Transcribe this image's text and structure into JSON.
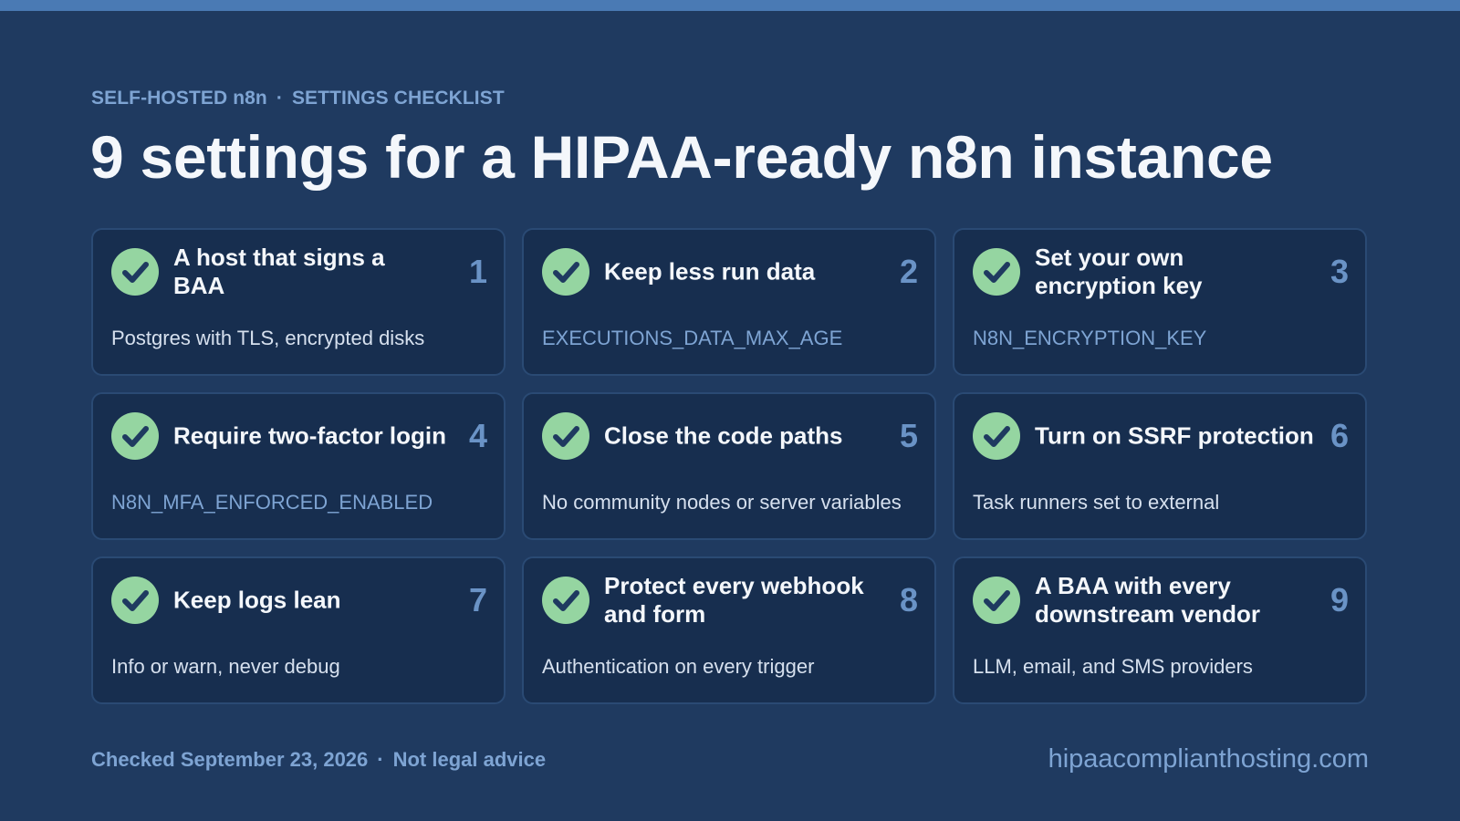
{
  "colors": {
    "background": "#1f3a60",
    "top_bar": "#4a7ab4",
    "card_background": "#172e4f",
    "card_border": "#2a4a74",
    "check_green": "#95d5a1",
    "check_mark": "#1f3a60",
    "accent_blue": "#7ea4d3",
    "number_blue": "#6a93c6",
    "title_white": "#f4f7fb"
  },
  "header": {
    "eyebrow_left": "SELF-HOSTED n8n",
    "eyebrow_separator": "·",
    "eyebrow_right": "SETTINGS CHECKLIST",
    "title": "9 settings for a HIPAA-ready n8n instance"
  },
  "cards": [
    {
      "number": "1",
      "title": "A host that signs a BAA",
      "subtitle": "Postgres with TLS, encrypted disks",
      "icon": "check-circle-icon"
    },
    {
      "number": "2",
      "title": "Keep less run data",
      "subtitle": "EXECUTIONS_DATA_MAX_AGE",
      "icon": "check-circle-icon"
    },
    {
      "number": "3",
      "title": "Set your own encryption key",
      "subtitle": "N8N_ENCRYPTION_KEY",
      "icon": "check-circle-icon"
    },
    {
      "number": "4",
      "title": "Require two-factor login",
      "subtitle": "N8N_MFA_ENFORCED_ENABLED",
      "icon": "check-circle-icon"
    },
    {
      "number": "5",
      "title": "Close the code paths",
      "subtitle": "No community nodes or server variables",
      "icon": "check-circle-icon"
    },
    {
      "number": "6",
      "title": "Turn on SSRF protection",
      "subtitle": "Task runners set to external",
      "icon": "check-circle-icon"
    },
    {
      "number": "7",
      "title": "Keep logs lean",
      "subtitle": "Info or warn, never debug",
      "icon": "check-circle-icon"
    },
    {
      "number": "8",
      "title": "Protect every webhook and form",
      "subtitle": "Authentication on every trigger",
      "icon": "check-circle-icon"
    },
    {
      "number": "9",
      "title": "A BAA with every downstream vendor",
      "subtitle": "LLM, email, and SMS providers",
      "icon": "check-circle-icon"
    }
  ],
  "footer": {
    "checked_date": "Checked September 23, 2026",
    "separator": "·",
    "disclaimer": "Not legal advice",
    "site": "hipaacomplianthosting.com"
  }
}
